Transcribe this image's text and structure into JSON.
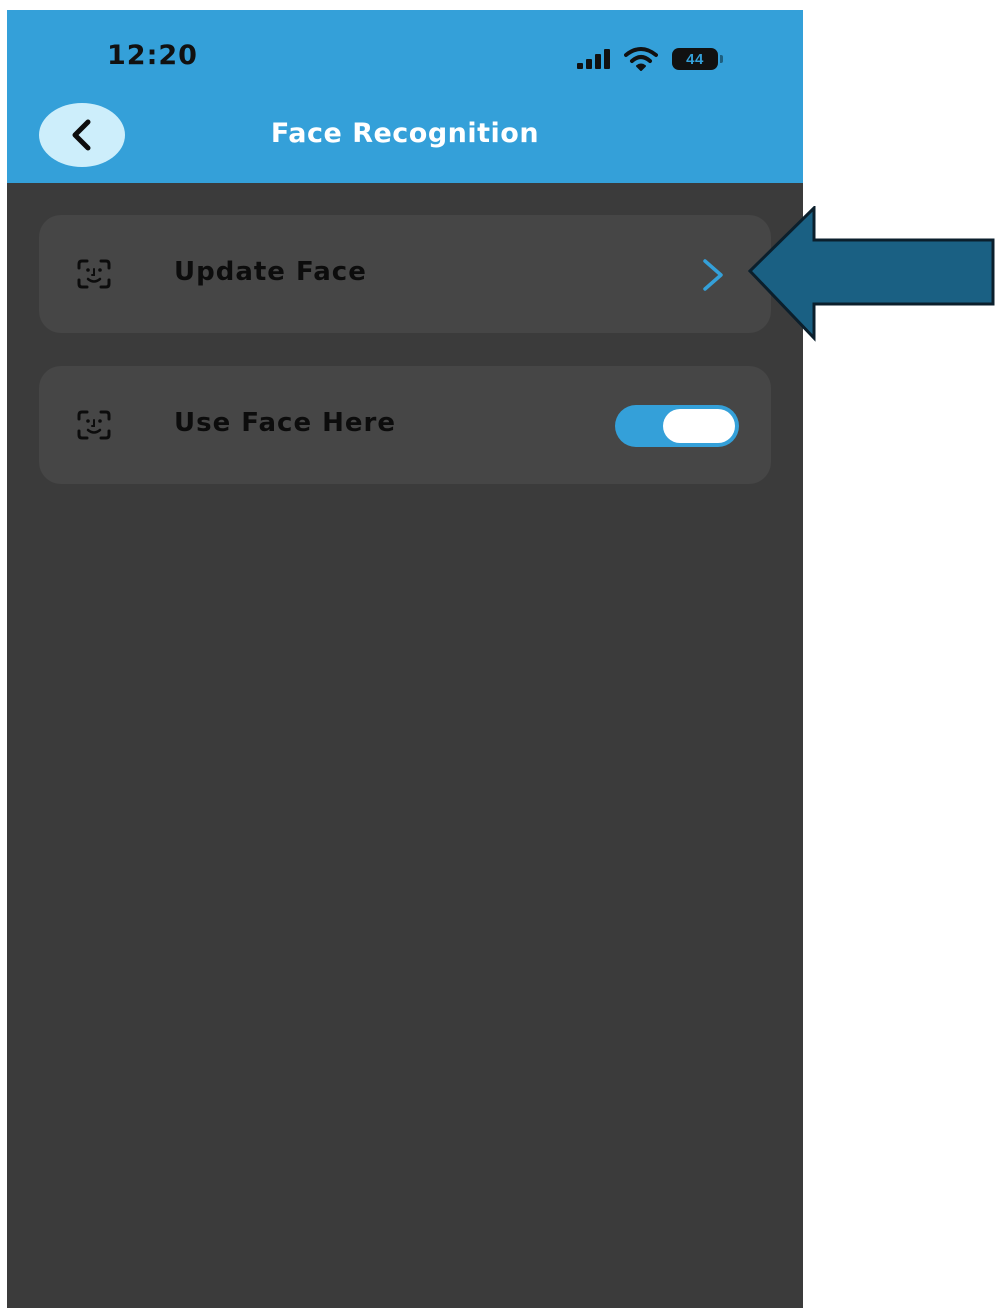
{
  "status_bar": {
    "time": "12:20",
    "battery": "44",
    "icons": [
      "signal-bars-icon",
      "wifi-icon",
      "battery-icon"
    ]
  },
  "header": {
    "title": "Face Recognition",
    "back_icon": "chevron-left-icon",
    "background_color": "#34a0d9"
  },
  "settings": {
    "update_face": {
      "label": "Update Face",
      "icon": "face-scan-icon",
      "trailing_icon": "chevron-right-icon"
    },
    "use_face_here": {
      "label": "Use Face Here",
      "icon": "face-scan-icon",
      "toggle_on": true
    }
  },
  "colors": {
    "accent": "#34a0d9",
    "page_background": "#3b3b3b",
    "row_background": "#464646",
    "annotation_arrow": "#1a6083"
  },
  "annotation": {
    "shape": "left-pointing arrow",
    "points_to": "update-face-chevron"
  }
}
